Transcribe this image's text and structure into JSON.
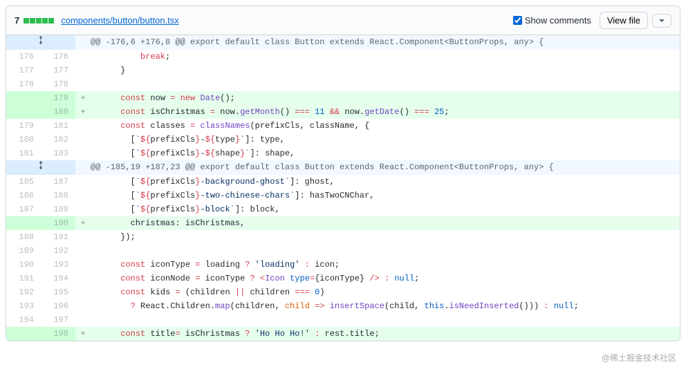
{
  "header": {
    "changeCount": "7",
    "diffstatBlocks": 5,
    "filePath": "components/button/button.tsx",
    "showCommentsLabel": "Show comments",
    "showCommentsChecked": true,
    "viewFileLabel": "View file"
  },
  "hunks": [
    {
      "header": "@@ -176,6 +176,8 @@ export default class Button extends React.Component<ButtonProps, any> {",
      "lines": [
        {
          "type": "ctx",
          "old": "176",
          "new": "176",
          "code": "          break;",
          "tokens": [
            [
              "          ",
              ""
            ],
            [
              "break",
              "tok-k"
            ],
            [
              ";",
              ""
            ]
          ]
        },
        {
          "type": "ctx",
          "old": "177",
          "new": "177",
          "code": "      }",
          "tokens": [
            [
              "      }",
              ""
            ]
          ]
        },
        {
          "type": "ctx",
          "old": "178",
          "new": "178",
          "code": "",
          "tokens": [
            [
              "",
              ""
            ]
          ]
        },
        {
          "type": "add",
          "old": "",
          "new": "179",
          "code": "      const now = new Date();",
          "tokens": [
            [
              "      ",
              ""
            ],
            [
              "const",
              "tok-k"
            ],
            [
              " now ",
              ""
            ],
            [
              "=",
              "tok-k"
            ],
            [
              " ",
              ""
            ],
            [
              "new",
              "tok-k"
            ],
            [
              " ",
              ""
            ],
            [
              "Date",
              "tok-en"
            ],
            [
              "();",
              ""
            ]
          ]
        },
        {
          "type": "add",
          "old": "",
          "new": "180",
          "code": "      const isChristmas = now.getMonth() === 11 && now.getDate() === 25;",
          "tokens": [
            [
              "      ",
              ""
            ],
            [
              "const",
              "tok-k"
            ],
            [
              " isChristmas ",
              ""
            ],
            [
              "=",
              "tok-k"
            ],
            [
              " now.",
              ""
            ],
            [
              "getMonth",
              "tok-en"
            ],
            [
              "() ",
              ""
            ],
            [
              "===",
              "tok-k"
            ],
            [
              " ",
              ""
            ],
            [
              "11",
              "tok-c1"
            ],
            [
              " ",
              ""
            ],
            [
              "&&",
              "tok-k"
            ],
            [
              " now.",
              ""
            ],
            [
              "getDate",
              "tok-en"
            ],
            [
              "() ",
              ""
            ],
            [
              "===",
              "tok-k"
            ],
            [
              " ",
              ""
            ],
            [
              "25",
              "tok-c1"
            ],
            [
              ";",
              ""
            ]
          ]
        },
        {
          "type": "ctx",
          "old": "179",
          "new": "181",
          "code": "      const classes = classNames(prefixCls, className, {",
          "tokens": [
            [
              "      ",
              ""
            ],
            [
              "const",
              "tok-k"
            ],
            [
              " classes ",
              ""
            ],
            [
              "=",
              "tok-k"
            ],
            [
              " ",
              ""
            ],
            [
              "classNames",
              "tok-en"
            ],
            [
              "(prefixCls, className, {",
              ""
            ]
          ]
        },
        {
          "type": "ctx",
          "old": "180",
          "new": "182",
          "code": "        [`${prefixCls}-${type}`]: type,",
          "tokens": [
            [
              "        [",
              ""
            ],
            [
              "`",
              "tok-s"
            ],
            [
              "${",
              "tok-k"
            ],
            [
              "prefixCls",
              ""
            ],
            [
              "}",
              "tok-k"
            ],
            [
              "-",
              "tok-s"
            ],
            [
              "${",
              "tok-k"
            ],
            [
              "type",
              ""
            ],
            [
              "}",
              "tok-k"
            ],
            [
              "`",
              "tok-s"
            ],
            [
              "]: type,",
              ""
            ]
          ]
        },
        {
          "type": "ctx",
          "old": "181",
          "new": "183",
          "code": "        [`${prefixCls}-${shape}`]: shape,",
          "tokens": [
            [
              "        [",
              ""
            ],
            [
              "`",
              "tok-s"
            ],
            [
              "${",
              "tok-k"
            ],
            [
              "prefixCls",
              ""
            ],
            [
              "}",
              "tok-k"
            ],
            [
              "-",
              "tok-s"
            ],
            [
              "${",
              "tok-k"
            ],
            [
              "shape",
              ""
            ],
            [
              "}",
              "tok-k"
            ],
            [
              "`",
              "tok-s"
            ],
            [
              "]: shape,",
              ""
            ]
          ]
        }
      ]
    },
    {
      "header": "@@ -185,19 +187,23 @@ export default class Button extends React.Component<ButtonProps, any> {",
      "lines": [
        {
          "type": "ctx",
          "old": "185",
          "new": "187",
          "code": "        [`${prefixCls}-background-ghost`]: ghost,",
          "tokens": [
            [
              "        [",
              ""
            ],
            [
              "`",
              "tok-s"
            ],
            [
              "${",
              "tok-k"
            ],
            [
              "prefixCls",
              ""
            ],
            [
              "}",
              "tok-k"
            ],
            [
              "-background-ghost",
              "tok-s"
            ],
            [
              "`",
              "tok-s"
            ],
            [
              "]: ghost,",
              ""
            ]
          ]
        },
        {
          "type": "ctx",
          "old": "186",
          "new": "188",
          "code": "        [`${prefixCls}-two-chinese-chars`]: hasTwoCNChar,",
          "tokens": [
            [
              "        [",
              ""
            ],
            [
              "`",
              "tok-s"
            ],
            [
              "${",
              "tok-k"
            ],
            [
              "prefixCls",
              ""
            ],
            [
              "}",
              "tok-k"
            ],
            [
              "-two-chinese-chars",
              "tok-s"
            ],
            [
              "`",
              "tok-s"
            ],
            [
              "]: hasTwoCNChar,",
              ""
            ]
          ]
        },
        {
          "type": "ctx",
          "old": "187",
          "new": "189",
          "code": "        [`${prefixCls}-block`]: block,",
          "tokens": [
            [
              "        [",
              ""
            ],
            [
              "`",
              "tok-s"
            ],
            [
              "${",
              "tok-k"
            ],
            [
              "prefixCls",
              ""
            ],
            [
              "}",
              "tok-k"
            ],
            [
              "-block",
              "tok-s"
            ],
            [
              "`",
              "tok-s"
            ],
            [
              "]: block,",
              ""
            ]
          ]
        },
        {
          "type": "add",
          "old": "",
          "new": "190",
          "code": "        christmas: isChristmas,",
          "tokens": [
            [
              "        christmas: isChristmas,",
              ""
            ]
          ]
        },
        {
          "type": "ctx",
          "old": "188",
          "new": "191",
          "code": "      });",
          "tokens": [
            [
              "      });",
              ""
            ]
          ]
        },
        {
          "type": "ctx",
          "old": "189",
          "new": "192",
          "code": "",
          "tokens": [
            [
              "",
              ""
            ]
          ]
        },
        {
          "type": "ctx",
          "old": "190",
          "new": "193",
          "code": "      const iconType = loading ? 'loading' : icon;",
          "tokens": [
            [
              "      ",
              ""
            ],
            [
              "const",
              "tok-k"
            ],
            [
              " iconType ",
              ""
            ],
            [
              "=",
              "tok-k"
            ],
            [
              " loading ",
              ""
            ],
            [
              "?",
              "tok-k"
            ],
            [
              " ",
              ""
            ],
            [
              "'loading'",
              "tok-s"
            ],
            [
              " ",
              ""
            ],
            [
              ":",
              "tok-k"
            ],
            [
              " icon;",
              ""
            ]
          ]
        },
        {
          "type": "ctx",
          "old": "191",
          "new": "194",
          "code": "      const iconNode = iconType ? <Icon type={iconType} /> : null;",
          "tokens": [
            [
              "      ",
              ""
            ],
            [
              "const",
              "tok-k"
            ],
            [
              " iconNode ",
              ""
            ],
            [
              "=",
              "tok-k"
            ],
            [
              " iconType ",
              ""
            ],
            [
              "?",
              "tok-k"
            ],
            [
              " ",
              ""
            ],
            [
              "<",
              "tok-k"
            ],
            [
              "Icon",
              "tok-en"
            ],
            [
              " ",
              ""
            ],
            [
              "type",
              "tok-c1"
            ],
            [
              "=",
              "tok-k"
            ],
            [
              "{iconType} ",
              ""
            ],
            [
              "/>",
              "tok-k"
            ],
            [
              " ",
              ""
            ],
            [
              ":",
              "tok-k"
            ],
            [
              " ",
              ""
            ],
            [
              "null",
              "tok-c1"
            ],
            [
              ";",
              ""
            ]
          ]
        },
        {
          "type": "ctx",
          "old": "192",
          "new": "195",
          "code": "      const kids = (children || children === 0)",
          "tokens": [
            [
              "      ",
              ""
            ],
            [
              "const",
              "tok-k"
            ],
            [
              " kids ",
              ""
            ],
            [
              "=",
              "tok-k"
            ],
            [
              " (children ",
              ""
            ],
            [
              "||",
              "tok-k"
            ],
            [
              " children ",
              ""
            ],
            [
              "===",
              "tok-k"
            ],
            [
              " ",
              ""
            ],
            [
              "0",
              "tok-c1"
            ],
            [
              ")",
              ""
            ]
          ]
        },
        {
          "type": "ctx",
          "old": "193",
          "new": "196",
          "code": "        ? React.Children.map(children, child => insertSpace(child, this.isNeedInserted())) : null;",
          "tokens": [
            [
              "        ",
              ""
            ],
            [
              "?",
              "tok-k"
            ],
            [
              " React.Children.",
              ""
            ],
            [
              "map",
              "tok-en"
            ],
            [
              "(children, ",
              ""
            ],
            [
              "child",
              "tok-v"
            ],
            [
              " ",
              ""
            ],
            [
              "=>",
              "tok-k"
            ],
            [
              " ",
              ""
            ],
            [
              "insertSpace",
              "tok-en"
            ],
            [
              "(child, ",
              ""
            ],
            [
              "this",
              "tok-c1"
            ],
            [
              ".",
              ""
            ],
            [
              "isNeedInserted",
              "tok-en"
            ],
            [
              "())) ",
              ""
            ],
            [
              ":",
              "tok-k"
            ],
            [
              " ",
              ""
            ],
            [
              "null",
              "tok-c1"
            ],
            [
              ";",
              ""
            ]
          ]
        },
        {
          "type": "ctx",
          "old": "194",
          "new": "197",
          "code": "",
          "tokens": [
            [
              "",
              ""
            ]
          ]
        },
        {
          "type": "add",
          "old": "",
          "new": "198",
          "code": "      const title= isChristmas ? 'Ho Ho Ho!' : rest.title;",
          "tokens": [
            [
              "      ",
              ""
            ],
            [
              "const",
              "tok-k"
            ],
            [
              " title",
              ""
            ],
            [
              "=",
              "tok-k"
            ],
            [
              " isChristmas ",
              ""
            ],
            [
              "?",
              "tok-k"
            ],
            [
              " ",
              ""
            ],
            [
              "'Ho Ho Ho!'",
              "tok-s"
            ],
            [
              " ",
              ""
            ],
            [
              ":",
              "tok-k"
            ],
            [
              " rest.title;",
              ""
            ]
          ]
        }
      ]
    }
  ],
  "watermark": "@稀土掘金技术社区"
}
